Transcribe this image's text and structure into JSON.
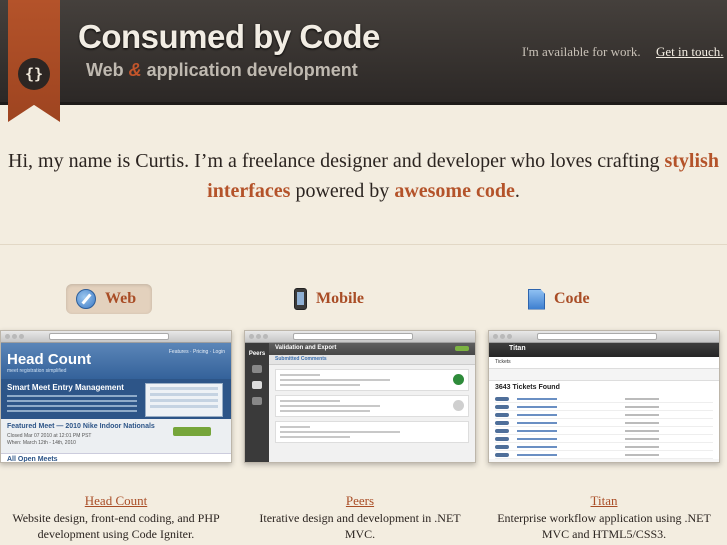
{
  "header": {
    "logo_glyph": "{}",
    "site_title": "Consumed by Code",
    "tagline_before": "Web ",
    "tagline_amp": "&",
    "tagline_after": " application development",
    "availability_text": "I'm available for work.",
    "contact_link": "Get in touch."
  },
  "intro": {
    "text_1": "Hi, my name is Curtis. I’m a freelance designer and developer who loves crafting ",
    "highlight_1": "stylish interfaces",
    "text_2": " powered by ",
    "highlight_2": "awesome code",
    "text_3": "."
  },
  "tabs": [
    {
      "label": "Web",
      "icon": "safari-compass-icon",
      "active": true
    },
    {
      "label": "Mobile",
      "icon": "iphone-icon",
      "active": false
    },
    {
      "label": "Code",
      "icon": "document-icon",
      "active": false
    }
  ],
  "portfolio": [
    {
      "name": "Head Count",
      "description": "Website design, front-end coding, and PHP development using Code Igniter.",
      "screenshot": {
        "logo": "Head Count",
        "logo_sub": "meet registration simplified",
        "nav": "Features · Pricing · Login",
        "hero_heading": "Smart Meet Entry Management",
        "featured_title": "Featured Meet — 2010 Nike Indoor Nationals",
        "featured_meta_1": "Closed Mar 07 2010 at 12:01 PM PST",
        "featured_meta_2": "When: March 12th - 14th, 2010",
        "section": "All Open Meets"
      }
    },
    {
      "name": "Peers",
      "description": "Iterative design and development in .NET MVC.",
      "screenshot": {
        "app": "Peers",
        "heading": "Validation and Export",
        "subheading": "Submitted Comments"
      }
    },
    {
      "name": "Titan",
      "description": "Enterprise workflow application using .NET MVC and HTML5/CSS3.",
      "screenshot": {
        "app": "Titan",
        "tab": "Tickets",
        "count_heading": "3643 Tickets Found"
      }
    }
  ],
  "colors": {
    "accent": "#b4532a",
    "header_bg": "#35302d",
    "page_bg": "#f3ede0"
  }
}
